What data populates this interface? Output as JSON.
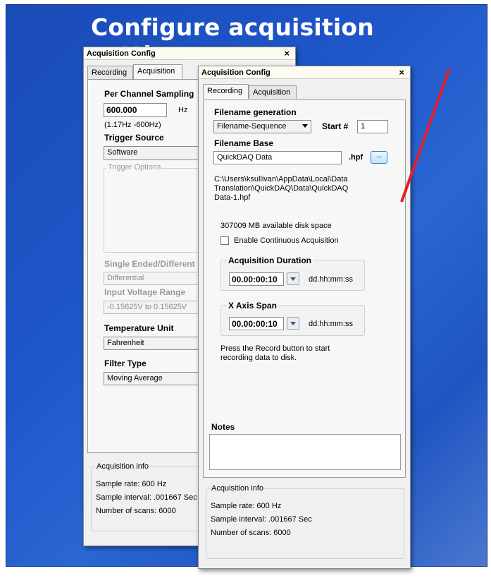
{
  "slide": {
    "title": "Configure acquisition settings",
    "accent_color": "#e01f2d"
  },
  "back_window": {
    "title": "Acquisition Config",
    "close_glyph": "×",
    "tabs": [
      "Recording",
      "Acquisition"
    ],
    "active_tab": "Acquisition",
    "sampling_label": "Per Channel Sampling",
    "sampling_value": "600.000",
    "sampling_unit": "Hz",
    "sampling_range": "(1.17Hz -600Hz)",
    "trigger_source_label": "Trigger Source",
    "trigger_source_value": "Software",
    "trigger_options_label": "Trigger Options",
    "single_ended_label": "Single Ended/Different",
    "single_ended_value": "Differential",
    "input_voltage_label": "Input Voltage Range",
    "input_voltage_value": "-0.15625V to 0.15625V",
    "temperature_label": "Temperature Unit",
    "temperature_value": "Fahrenheit",
    "filter_label": "Filter Type",
    "filter_value": "Moving Average",
    "info_title": "Acquisition info",
    "info_rate": "Sample rate: 600 Hz",
    "info_interval": "Sample interval: .001667 Sec",
    "info_scans": "Number of scans: 6000"
  },
  "front_window": {
    "title": "Acquisition Config",
    "close_glyph": "×",
    "tabs": [
      "Recording",
      "Acquisition"
    ],
    "active_tab": "Recording",
    "filename_gen_label": "Filename generation",
    "filename_gen_value": "Filename-Sequence",
    "start_label": "Start #",
    "start_value": "1",
    "filename_base_label": "Filename Base",
    "filename_base_value": "QuickDAQ Data",
    "extension": ".hpf",
    "browse_label": "...",
    "path_line1": "C:\\Users\\ksullivan\\AppData\\Local\\Data",
    "path_line2": "Translation\\QuickDAQ\\Data\\QuickDAQ",
    "path_line3": "Data-1.hpf",
    "disk_space": "307009 MB available disk space",
    "continuous_label": "Enable Continuous Acquisition",
    "continuous_checked": false,
    "duration_label": "Acquisition Duration",
    "duration_value": "00.00:00:10",
    "duration_format": "dd.hh:mm:ss",
    "span_label": "X Axis Span",
    "span_value": "00.00:00:10",
    "span_format": "dd.hh:mm:ss",
    "hint_line1": "Press the Record button to start",
    "hint_line2": "recording data to disk.",
    "notes_label": "Notes",
    "info_title": "Acquisition info",
    "info_rate": "Sample rate: 600 Hz",
    "info_interval": "Sample interval: .001667 Sec",
    "info_scans": "Number of scans: 6000"
  }
}
